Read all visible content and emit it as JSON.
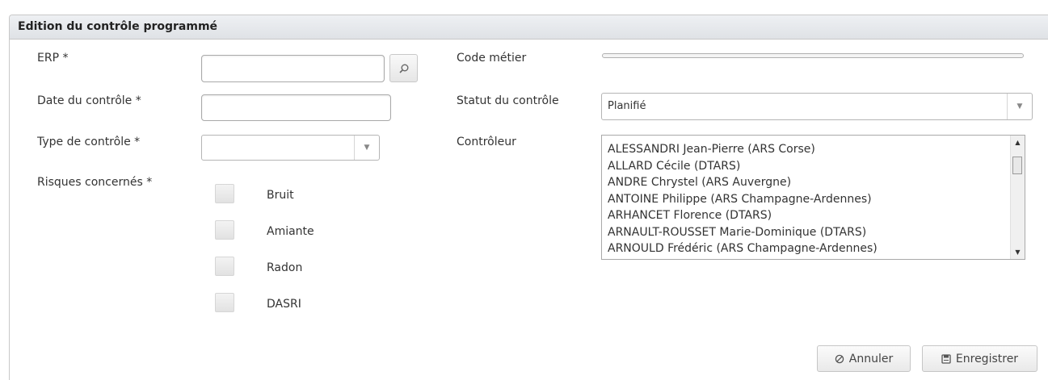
{
  "panel": {
    "title": "Edition du contrôle programmé"
  },
  "form": {
    "erp_label": "ERP *",
    "erp_value": "",
    "date_label": "Date du contrôle *",
    "date_value": "",
    "type_label": "Type de contrôle *",
    "type_value": "",
    "risques_label": "Risques concernés *",
    "risques": [
      {
        "label": "Bruit",
        "checked": false
      },
      {
        "label": "Amiante",
        "checked": false
      },
      {
        "label": "Radon",
        "checked": false
      },
      {
        "label": "DASRI",
        "checked": false
      }
    ],
    "code_label": "Code métier",
    "code_value": "",
    "statut_label": "Statut du contrôle",
    "statut_value": "Planifié",
    "controleur_label": "Contrôleur",
    "controleurs": [
      "ALESSANDRI Jean-Pierre (ARS Corse)",
      "ALLARD Cécile (DTARS)",
      "ANDRE Chrystel (ARS Auvergne)",
      "ANTOINE Philippe (ARS Champagne-Ardennes)",
      "ARHANCET Florence (DTARS)",
      "ARNAULT-ROUSSET Marie-Dominique (DTARS)",
      "ARNOULD Frédéric (ARS Champagne-Ardennes)"
    ]
  },
  "actions": {
    "cancel_label": "Annuler",
    "save_label": "Enregistrer"
  },
  "icons": {
    "search": "search-icon",
    "cancel": "cancel-icon",
    "save": "save-icon",
    "dropdown": "chevron-down-icon"
  }
}
